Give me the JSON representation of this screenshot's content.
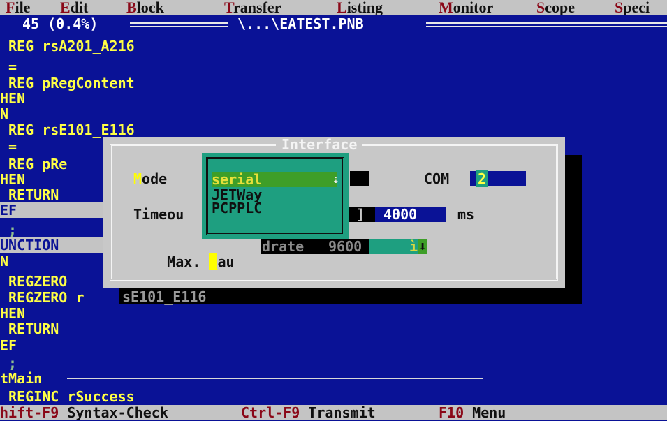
{
  "menubar": {
    "items": [
      {
        "hotkey": "F",
        "rest": "ile"
      },
      {
        "hotkey": "E",
        "rest": "dit"
      },
      {
        "hotkey": "B",
        "rest": "lock"
      },
      {
        "hotkey": "T",
        "rest": "ransfer"
      },
      {
        "hotkey": "L",
        "rest": "isting"
      },
      {
        "hotkey": "M",
        "rest": "onitor"
      },
      {
        "hotkey": "S",
        "rest": "cope"
      },
      {
        "hotkey": "S",
        "rest": "peci"
      }
    ]
  },
  "editor": {
    "position": "45 (0.4%)",
    "filename": "\\...\\EATEST.PNB",
    "lines": [
      " REG rsA201_A216",
      " =",
      " REG pRegContent",
      "HEN",
      "N",
      " REG rsE101_E116",
      " =",
      " REG pRe",
      "HEN",
      " RETURN",
      "EF",
      " ;",
      "UNCTION",
      "N",
      " REGZERO",
      " REGZERO r",
      "HEN",
      " RETURN",
      "EF",
      " ;",
      "tMain",
      " REGINC rSuccess"
    ],
    "fragment_line15": "sE101_E116"
  },
  "dialog": {
    "title": "Interface",
    "mode_hotkey": "M",
    "mode_label": "ode",
    "timeout_label": "Timeou",
    "timeout_bracket": "]",
    "timeout_value": "4000",
    "timeout_unit": "ms",
    "baud_label_pre": "Max. ",
    "baud_hotkey": "B",
    "baud_label_rest": "au",
    "baud_label_tail": "drate",
    "baud_value": "9600",
    "baud_arrow_glyph": "ì",
    "com_label": "COM",
    "com_value": "2"
  },
  "dropdown": {
    "options": [
      "serial",
      "JETWay",
      "PCPPLC"
    ],
    "selected": "serial"
  },
  "statusbar": {
    "items": [
      {
        "hotkey": "hift-F9",
        "label": "Syntax-Check"
      },
      {
        "hotkey": "Ctrl-F9",
        "label": "Transmit"
      },
      {
        "hotkey": "F10",
        "label": "Menu"
      }
    ]
  },
  "colors": {
    "background": "#0a1296",
    "menubar": "#c4c4c4",
    "hotkey": "#8a0818",
    "code": "#ffff44",
    "dialog": "#c8c8c8",
    "dropdown": "#1e9f80"
  }
}
